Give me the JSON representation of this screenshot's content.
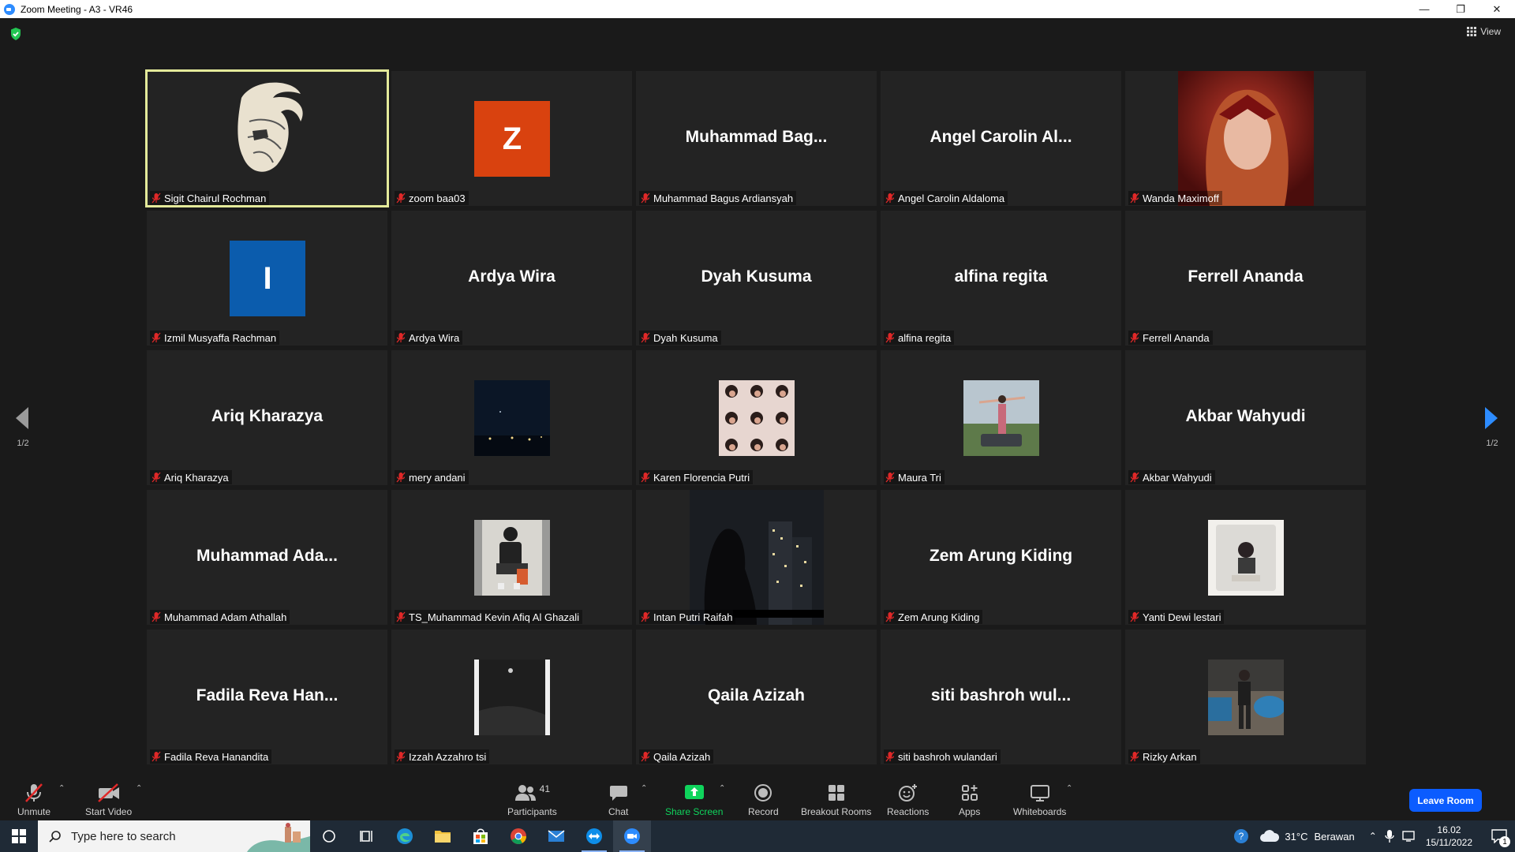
{
  "window": {
    "title": "Zoom Meeting - A3 - VR46",
    "controls": [
      "minimize",
      "restore",
      "close"
    ]
  },
  "topbar": {
    "view_label": "View"
  },
  "pager": {
    "left": "1/2",
    "right": "1/2"
  },
  "tiles": [
    {
      "label": "Sigit Chairul Rochman",
      "display": "",
      "kind": "sketch",
      "active": true
    },
    {
      "label": "zoom baa03",
      "display": "Z",
      "kind": "avatar",
      "color": "#d9420f"
    },
    {
      "label": "Muhammad Bagus Ardiansyah",
      "display": "Muhammad Bag...",
      "kind": "name"
    },
    {
      "label": "Angel Carolin Aldaloma",
      "display": "Angel Carolin Al...",
      "kind": "name"
    },
    {
      "label": "Wanda Maximoff",
      "display": "",
      "kind": "wanda"
    },
    {
      "label": "Izmil Musyaffa Rachman",
      "display": "I",
      "kind": "avatar",
      "color": "#0b5cad"
    },
    {
      "label": "Ardya Wira",
      "display": "Ardya Wira",
      "kind": "name"
    },
    {
      "label": "Dyah Kusuma",
      "display": "Dyah Kusuma",
      "kind": "name"
    },
    {
      "label": "alfina regita",
      "display": "alfina regita",
      "kind": "name"
    },
    {
      "label": "Ferrell Ananda",
      "display": "Ferrell Ananda",
      "kind": "name"
    },
    {
      "label": "Ariq Kharazya",
      "display": "Ariq Kharazya",
      "kind": "name"
    },
    {
      "label": "mery andani",
      "display": "",
      "kind": "night"
    },
    {
      "label": "Karen Florencia Putri",
      "display": "",
      "kind": "collage"
    },
    {
      "label": "Maura Tri",
      "display": "",
      "kind": "outdoor"
    },
    {
      "label": "Akbar Wahyudi",
      "display": "Akbar Wahyudi",
      "kind": "name"
    },
    {
      "label": "Muhammad Adam Athallah",
      "display": "Muhammad Ada...",
      "kind": "name"
    },
    {
      "label": "TS_Muhammad Kevin Afiq Al Ghazali",
      "display": "",
      "kind": "seated"
    },
    {
      "label": "Intan Putri Raifah",
      "display": "",
      "kind": "city"
    },
    {
      "label": "Zem Arung Kiding",
      "display": "Zem Arung Kiding",
      "kind": "name"
    },
    {
      "label": "Yanti Dewi lestari",
      "display": "",
      "kind": "mirror"
    },
    {
      "label": "Fadila Reva Hanandita",
      "display": "Fadila Reva Han...",
      "kind": "name"
    },
    {
      "label": "Izzah Azzahro tsi",
      "display": "",
      "kind": "dark"
    },
    {
      "label": "Qaila Azizah",
      "display": "Qaila Azizah",
      "kind": "name"
    },
    {
      "label": "siti bashroh wulandari",
      "display": "siti bashroh wul...",
      "kind": "name"
    },
    {
      "label": "Rizky Arkan",
      "display": "",
      "kind": "pool"
    }
  ],
  "toolbar": {
    "unmute": "Unmute",
    "start_video": "Start Video",
    "participants": "Participants",
    "participants_count": "41",
    "chat": "Chat",
    "share_screen": "Share Screen",
    "record": "Record",
    "breakout_rooms": "Breakout Rooms",
    "reactions": "Reactions",
    "apps": "Apps",
    "whiteboards": "Whiteboards",
    "leave_room": "Leave Room",
    "share_color": "#0fd45c",
    "leave_color": "#0b5cff"
  },
  "taskbar": {
    "search_placeholder": "Type here to search",
    "weather_temp": "31°C",
    "weather_text": "Berawan",
    "time": "16.02",
    "date": "15/11/2022",
    "notification_count": "1"
  }
}
